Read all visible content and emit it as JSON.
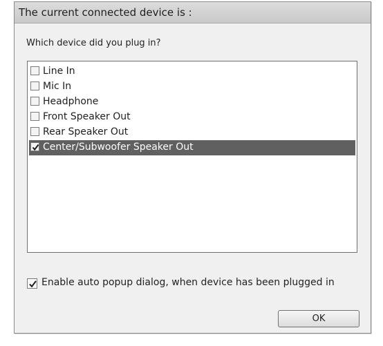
{
  "dialog": {
    "title": "The current connected device is :",
    "prompt": "Which device did you plug in?"
  },
  "devices": [
    {
      "label": "Line In",
      "checked": false,
      "selected": false
    },
    {
      "label": "Mic In",
      "checked": false,
      "selected": false
    },
    {
      "label": "Headphone",
      "checked": false,
      "selected": false
    },
    {
      "label": "Front Speaker Out",
      "checked": false,
      "selected": false
    },
    {
      "label": "Rear Speaker Out",
      "checked": false,
      "selected": false
    },
    {
      "label": "Center/Subwoofer Speaker Out",
      "checked": true,
      "selected": true
    }
  ],
  "auto_popup": {
    "label": "Enable auto popup dialog, when device has been plugged in",
    "checked": true
  },
  "buttons": {
    "ok_label": "OK"
  },
  "colors": {
    "selected_row_bg": "#606060",
    "selected_row_text": "#ffffff",
    "dialog_bg": "#f0f0f0"
  },
  "icons": {
    "checkbox_checked": "checkmark-icon",
    "checkbox_unchecked": "empty-checkbox"
  }
}
